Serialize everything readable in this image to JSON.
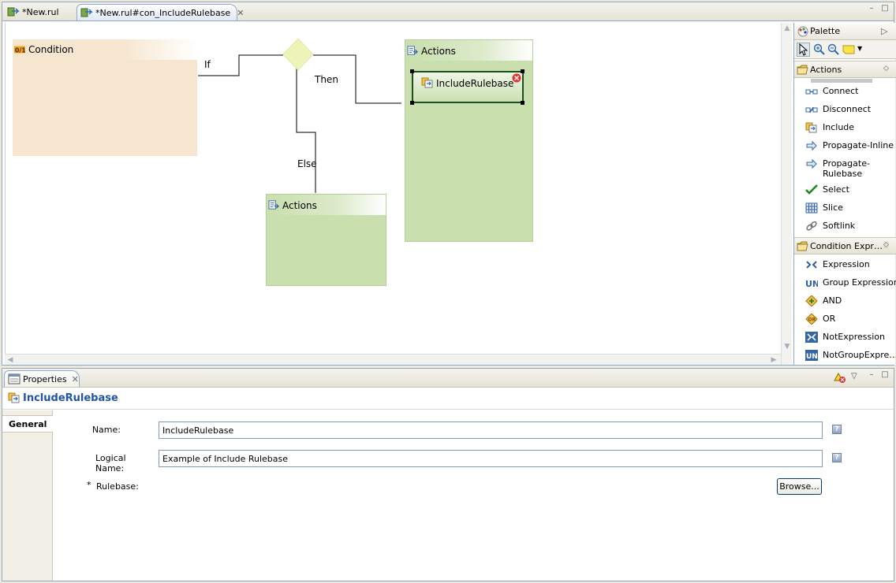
{
  "editor": {
    "tabs": [
      {
        "label": "*New.rul",
        "active": false
      },
      {
        "label": "*New.rul#con_IncludeRulebase",
        "active": true
      }
    ],
    "window_buttons": {
      "minimize": "–",
      "maximize": "□"
    }
  },
  "diagram": {
    "condition_label": "Condition",
    "decision_icon": "diamond-shape",
    "edge_labels": {
      "if": "If",
      "then": "Then",
      "else": "Else"
    },
    "then_actions_label": "Actions",
    "else_actions_label": "Actions",
    "include_node_label": "IncludeRulebase",
    "colors": {
      "condition": "#f7e6cf",
      "actions": "#c9dfad",
      "decision": "#eef3b8",
      "error": "#e03030"
    }
  },
  "palette": {
    "title": "Palette",
    "drawers": [
      {
        "label": "Actions",
        "items": [
          {
            "label": "Connect",
            "icon": "connect-icon"
          },
          {
            "label": "Disconnect",
            "icon": "disconnect-icon"
          },
          {
            "label": "Include",
            "icon": "include-icon"
          },
          {
            "label": "Propagate-Inline",
            "icon": "propagate-icon"
          },
          {
            "label": "Propagate-Rulebase",
            "label_line1": "Propagate-",
            "label_line2": "Rulebase",
            "icon": "propagate-icon"
          },
          {
            "label": "Select",
            "icon": "checkmark-icon"
          },
          {
            "label": "Slice",
            "icon": "slice-icon"
          },
          {
            "label": "Softlink",
            "icon": "link-icon"
          }
        ]
      },
      {
        "label": "Condition Expr…",
        "items": [
          {
            "label": "Expression",
            "icon": "expression-icon"
          },
          {
            "label": "Group Expression",
            "icon": "group-expression-icon"
          },
          {
            "label": "AND",
            "icon": "and-icon"
          },
          {
            "label": "OR",
            "icon": "or-icon"
          },
          {
            "label": "NotExpression",
            "icon": "not-expression-icon"
          },
          {
            "label": "NotGroupExpre…",
            "icon": "not-group-expression-icon"
          }
        ]
      }
    ]
  },
  "properties": {
    "tab_label": "Properties",
    "title": "IncludeRulebase",
    "side_tabs": [
      "General"
    ],
    "fields": {
      "name": {
        "label": "Name:",
        "value": "IncludeRulebase"
      },
      "logical_name": {
        "label": "Logical Name:",
        "value": "Example of Include Rulebase"
      },
      "rulebase": {
        "label": "Rulebase:",
        "required_marker": "*",
        "browse_label": "Browse..."
      }
    },
    "help_glyph": "?"
  }
}
